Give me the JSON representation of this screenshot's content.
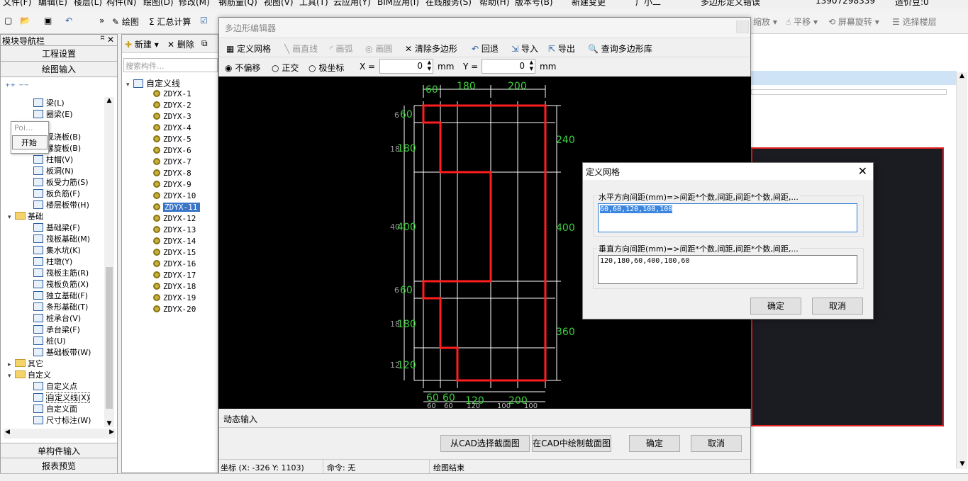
{
  "menubar": [
    "文件(F)",
    "编辑(E)",
    "楼层(L)",
    "构件(N)",
    "绘图(D)",
    "修改(M)",
    "钢筋量(Q)",
    "视图(V)",
    "工具(T)",
    "云应用(Y)",
    "BIM应用(I)",
    "在线服务(S)",
    "帮助(H)",
    "版本号(B)",
    "新建变更",
    "广小二",
    "多边形定义错误",
    "13907298339",
    "造价豆:0"
  ],
  "toolbar": {
    "draw": "绘图",
    "sum": "汇总计算",
    "zoom": "缩放",
    "pan": "平移",
    "rotate": "屏幕旋转",
    "select_floor": "选择楼层"
  },
  "nav": {
    "title": "模块导航栏",
    "project_settings": "工程设置",
    "draw_input": "绘图输入",
    "single_input": "单构件输入",
    "report": "报表预览",
    "popup_label": "Poi...",
    "popup_start": "开始",
    "items": [
      {
        "label": "梁(L)",
        "kind": "item"
      },
      {
        "label": "圈梁(E)",
        "kind": "item"
      },
      {
        "label": "现浇板(B)",
        "kind": "item"
      },
      {
        "label": "螺旋板(B)",
        "kind": "item"
      },
      {
        "label": "柱帽(V)",
        "kind": "item"
      },
      {
        "label": "板洞(N)",
        "kind": "item"
      },
      {
        "label": "板受力筋(S)",
        "kind": "item"
      },
      {
        "label": "板负筋(F)",
        "kind": "item"
      },
      {
        "label": "楼层板带(H)",
        "kind": "item"
      },
      {
        "label": "基础",
        "kind": "folder"
      },
      {
        "label": "基础梁(F)",
        "kind": "item"
      },
      {
        "label": "筏板基础(M)",
        "kind": "item"
      },
      {
        "label": "集水坑(K)",
        "kind": "item"
      },
      {
        "label": "柱墩(Y)",
        "kind": "item"
      },
      {
        "label": "筏板主筋(R)",
        "kind": "item"
      },
      {
        "label": "筏板负筋(X)",
        "kind": "item"
      },
      {
        "label": "独立基础(F)",
        "kind": "item"
      },
      {
        "label": "条形基础(T)",
        "kind": "item"
      },
      {
        "label": "桩承台(V)",
        "kind": "item"
      },
      {
        "label": "承台梁(F)",
        "kind": "item"
      },
      {
        "label": "桩(U)",
        "kind": "item"
      },
      {
        "label": "基础板带(W)",
        "kind": "item"
      },
      {
        "label": "其它",
        "kind": "folder"
      },
      {
        "label": "自定义",
        "kind": "folder"
      },
      {
        "label": "自定义点",
        "kind": "item"
      },
      {
        "label": "自定义线(X)",
        "kind": "item"
      },
      {
        "label": "自定义面",
        "kind": "item"
      },
      {
        "label": "尺寸标注(W)",
        "kind": "item"
      }
    ]
  },
  "component_list": {
    "new": "新建",
    "delete": "删除",
    "search_placeholder": "搜索构件...",
    "root": "自定义线",
    "items": [
      "ZDYX-1",
      "ZDYX-2",
      "ZDYX-3",
      "ZDYX-4",
      "ZDYX-5",
      "ZDYX-6",
      "ZDYX-7",
      "ZDYX-8",
      "ZDYX-9",
      "ZDYX-10",
      "ZDYX-11",
      "ZDYX-12",
      "ZDYX-13",
      "ZDYX-14",
      "ZDYX-15",
      "ZDYX-16",
      "ZDYX-17",
      "ZDYX-18",
      "ZDYX-19",
      "ZDYX-20"
    ],
    "selected": "ZDYX-11"
  },
  "editor": {
    "title": "多边形编辑器",
    "tools": {
      "define_grid": "定义网格",
      "line": "画直线",
      "arc": "画弧",
      "circle": "画圆",
      "clear": "清除多边形",
      "undo": "回退",
      "import": "导入",
      "export": "导出",
      "query": "查询多边形库"
    },
    "options": {
      "no_offset": "不偏移",
      "ortho": "正交",
      "polar": "极坐标"
    },
    "x_label": "X =",
    "x_value": "0",
    "y_label": "Y =",
    "y_value": "0",
    "unit": "mm",
    "dynamic_input": "动态输入",
    "btn_from_cad": "从CAD选择截面图",
    "btn_draw_cad": "在CAD中绘制截面图",
    "btn_ok": "确定",
    "btn_cancel": "取消",
    "status_coord": "坐标 (X: -326 Y: 1103)",
    "status_cmd": "命令: 无",
    "status_msg": "绘图结束"
  },
  "dims": {
    "top": [
      "60",
      "180",
      "200"
    ],
    "right": [
      "240",
      "400",
      "360"
    ],
    "left": [
      "60",
      "180",
      "400",
      "60",
      "180",
      "120"
    ],
    "left_small": [
      "6",
      "18",
      "40",
      "6",
      "18",
      "12"
    ],
    "bottom": [
      "60",
      "60",
      "120",
      "200"
    ],
    "bottom_small": [
      "60",
      "60",
      "120",
      "100",
      "100"
    ]
  },
  "dialog": {
    "title": "定义网格",
    "h_label": "水平方向间距(mm)=>间距*个数,间距,间距*个数,间距,...",
    "h_value": "60,60,120,100,100",
    "v_label": "垂直方向间距(mm)=>间距*个数,间距,间距*个数,间距,...",
    "v_value": "120,180,60,400,180,60",
    "ok": "确定",
    "cancel": "取消"
  }
}
